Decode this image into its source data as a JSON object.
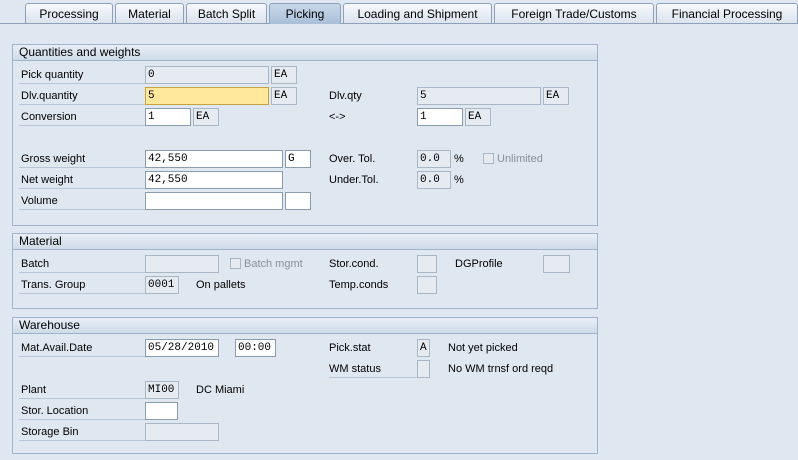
{
  "tabs": [
    "Processing",
    "Material",
    "Batch Split",
    "Picking",
    "Loading and Shipment",
    "Foreign Trade/Customs",
    "Financial Processing"
  ],
  "qw": {
    "title": "Quantities and weights",
    "pick_qty_label": "Pick quantity",
    "pick_qty": "0",
    "pick_uom": "EA",
    "dlv_qty_label": "Dlv.quantity",
    "dlv_qty": "5",
    "dlv_uom": "EA",
    "dlv_qty2_label": "Dlv.qty",
    "dlv_qty2": "5",
    "dlv_qty2_uom": "EA",
    "conv_label": "Conversion",
    "conv_val": "1",
    "conv_uom": "EA",
    "arrow_label": "<->",
    "arrow_val": "1",
    "arrow_uom": "EA",
    "gross_label": "Gross weight",
    "gross": "42,550",
    "gross_uom": "G",
    "net_label": "Net weight",
    "net": "42,550",
    "volume_label": "Volume",
    "volume": "",
    "volume_uom": "",
    "over_label": "Over. Tol.",
    "over": "0.0",
    "over_unit": "%",
    "under_label": "Under.Tol.",
    "under": "0.0",
    "under_unit": "%",
    "unlimited_label": "Unlimited"
  },
  "mat": {
    "title": "Material",
    "batch_label": "Batch",
    "batch": "",
    "batch_mgmt_label": "Batch mgmt",
    "stor_cond_label": "Stor.cond.",
    "stor_cond": "",
    "dg_label": "DGProfile",
    "dg": "",
    "trans_label": "Trans. Group",
    "trans": "0001",
    "trans_text": "On pallets",
    "temp_label": "Temp.conds",
    "temp": ""
  },
  "wh": {
    "title": "Warehouse",
    "mad_label": "Mat.Avail.Date",
    "mad": "05/28/2010",
    "mad_time": "00:00",
    "pick_stat_label": "Pick.stat",
    "pick_stat": "A",
    "pick_stat_text": "Not yet picked",
    "wm_label": "WM status",
    "wm": "",
    "wm_text": "No WM trnsf ord reqd",
    "plant_label": "Plant",
    "plant": "MI00",
    "plant_text": "DC Miami",
    "sloc_label": "Stor. Location",
    "sloc": "",
    "bin_label": "Storage Bin",
    "bin": ""
  }
}
